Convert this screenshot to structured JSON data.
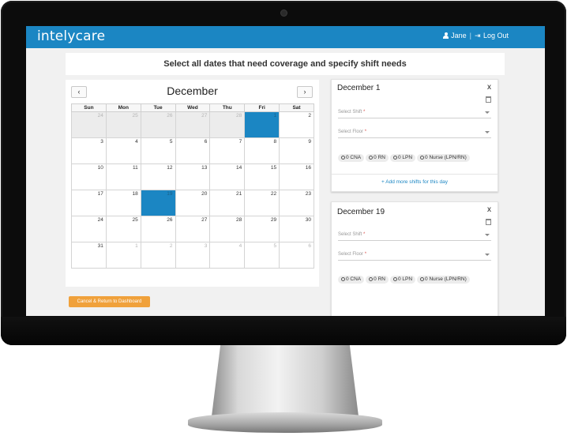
{
  "app": {
    "logo": "intelycare"
  },
  "header": {
    "user_name": "Jane",
    "logout_label": "Log Out"
  },
  "page": {
    "instruction": "Select all dates that need coverage and specify shift needs"
  },
  "calendar": {
    "month": "December",
    "prev_label": "‹",
    "next_label": "›",
    "weekdays": [
      "Sun",
      "Mon",
      "Tue",
      "Wed",
      "Thu",
      "Fri",
      "Sat"
    ],
    "weeks": [
      [
        "24",
        "25",
        "26",
        "27",
        "28",
        "1",
        "2"
      ],
      [
        "3",
        "4",
        "5",
        "6",
        "7",
        "8",
        "9"
      ],
      [
        "10",
        "11",
        "12",
        "13",
        "14",
        "15",
        "16"
      ],
      [
        "17",
        "18",
        "19",
        "20",
        "21",
        "22",
        "23"
      ],
      [
        "24",
        "25",
        "26",
        "27",
        "28",
        "29",
        "30"
      ],
      [
        "31",
        "1",
        "2",
        "3",
        "4",
        "5",
        "6"
      ]
    ],
    "selected_dates": [
      "December 1",
      "December 19"
    ]
  },
  "day_panels": [
    {
      "date": "December 1",
      "close_label": "x",
      "shift_placeholder": "Select Shift",
      "floor_placeholder": "Select Floor",
      "required_mark": "*",
      "chips": [
        "0 CNA",
        "0 RN",
        "0 LPN",
        "0 Nurse (LPN/RN)"
      ],
      "add_more_label": "+ Add more shifts for this day"
    },
    {
      "date": "December 19",
      "close_label": "x",
      "shift_placeholder": "Select Shift",
      "floor_placeholder": "Select Floor",
      "required_mark": "*",
      "chips": [
        "0 CNA",
        "0 RN",
        "0 LPN",
        "0 Nurse (LPN/RN)"
      ]
    }
  ],
  "footer": {
    "cancel_label": "Cancel & Return to Dashboard"
  },
  "colors": {
    "brand": "#1b86c3",
    "accent": "#f0a13b"
  },
  "icons": [
    "user-icon",
    "logout-icon",
    "trash-icon",
    "person-icon",
    "chevron-left-icon",
    "chevron-right-icon"
  ]
}
